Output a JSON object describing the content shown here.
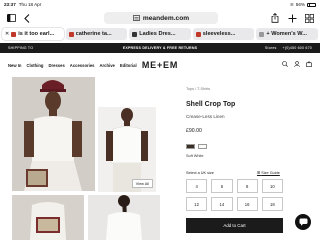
{
  "status": {
    "time": "23:37",
    "date": "Thu 18 Apr",
    "battery": "56%"
  },
  "browser": {
    "url": "meandem.com",
    "tabs": [
      {
        "label": "is it too earl..."
      },
      {
        "label": "catherine ta..."
      },
      {
        "label": "Ladies Dres..."
      },
      {
        "label": "sleeveless..."
      },
      {
        "label": "+ Women's W..."
      }
    ]
  },
  "promo": {
    "left": "SHIPPING TO",
    "center": "EXPRESS DELIVERY & FREE RETURNS",
    "stores": "Stores",
    "phone": "+(0)450 600 670"
  },
  "nav": {
    "links": [
      "New In",
      "Clothing",
      "Dresses",
      "Accessories",
      "Archive",
      "Editorial"
    ],
    "logo": "ME+EM"
  },
  "gallery": {
    "view_all": "View All"
  },
  "product": {
    "breadcrumb": "Tops  /  T-Shirts",
    "title": "Shell Crop Top",
    "subtitle": "Crease-Less Linen",
    "price": "£90.00",
    "color_name": "Soft White",
    "size_prompt": "Select a UK size",
    "size_guide": "Size Guide",
    "sizes": [
      "4",
      "6",
      "8",
      "10",
      "12",
      "14",
      "16",
      "18"
    ],
    "add_to_cart": "Add to Cart"
  }
}
